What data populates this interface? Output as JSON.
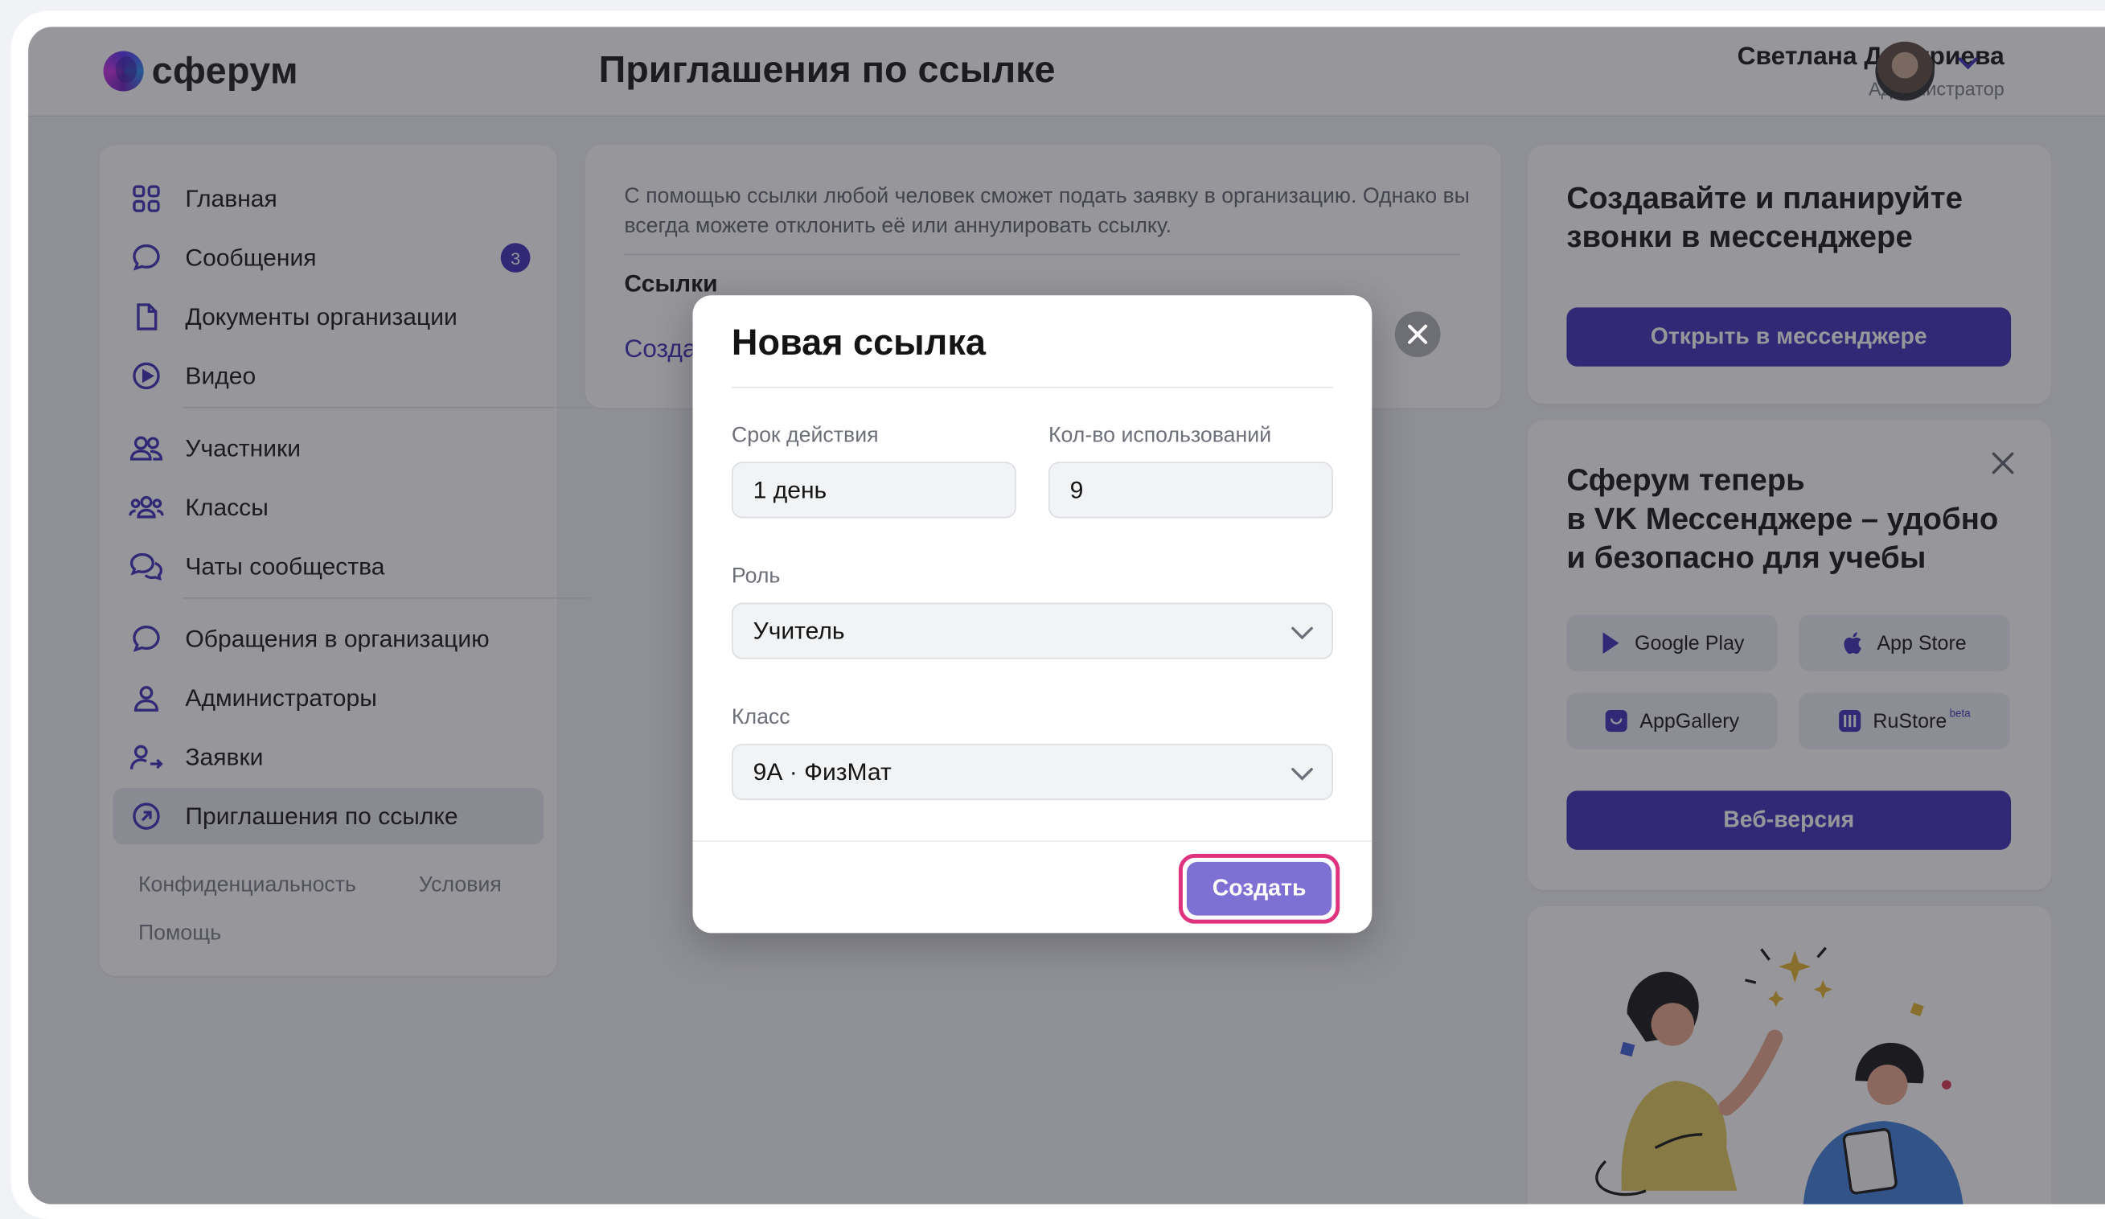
{
  "app": {
    "logo_text": "сферум"
  },
  "header": {
    "title": "Приглашения по ссылке",
    "user_name": "Светлана Дмитриева",
    "user_role": "Администратор"
  },
  "sidebar": {
    "items": [
      {
        "label": "Главная",
        "icon": "grid-icon"
      },
      {
        "label": "Сообщения",
        "icon": "chat-bubble-icon",
        "badge": "3"
      },
      {
        "label": "Документы организации",
        "icon": "document-icon"
      },
      {
        "label": "Видео",
        "icon": "play-circle-icon"
      },
      {
        "label": "Участники",
        "icon": "people-icon"
      },
      {
        "label": "Классы",
        "icon": "group-icon"
      },
      {
        "label": "Чаты сообщества",
        "icon": "chats-icon"
      },
      {
        "label": "Обращения в организацию",
        "icon": "chat-bubble-icon"
      },
      {
        "label": "Администраторы",
        "icon": "person-icon"
      },
      {
        "label": "Заявки",
        "icon": "person-arrow-icon"
      },
      {
        "label": "Приглашения по ссылке",
        "icon": "link-arrow-circle-icon",
        "active": true
      }
    ],
    "footer": {
      "privacy": "Конфиденциальность",
      "terms": "Условия",
      "help": "Помощь"
    }
  },
  "main": {
    "info": "С помощью ссылки любой человек сможет подать заявку в организацию. Однако вы всегда можете отклонить её или аннулировать ссылку.",
    "links_title": "Ссылки",
    "create_link_partial": "Созда"
  },
  "promo1": {
    "title_line1": "Создавайте и планируйте",
    "title_line2": "звонки в мессенджере",
    "button": "Открыть в мессенджере"
  },
  "promo2": {
    "title_line1": "Сферум теперь",
    "title_line2": "в VK Мессенджере – удобно",
    "title_line3": "и безопасно для учебы",
    "stores": {
      "google": "Google Play",
      "apple": "App Store",
      "huawei": "AppGallery",
      "rustore": "RuStore",
      "rustore_sup": "beta"
    },
    "web_button": "Веб-версия"
  },
  "modal": {
    "title": "Новая ссылка",
    "duration_label": "Срок  действия",
    "duration_value": "1 день",
    "uses_label": "Кол-во использований",
    "uses_value": "9",
    "role_label": "Роль",
    "role_value": "Учитель",
    "class_label": "Класс",
    "class_value": "9А · ФизМат",
    "create_button": "Создать"
  },
  "colors": {
    "accent": "#3f2fb6",
    "highlight": "#e0337f",
    "overlay": "#23242d"
  }
}
